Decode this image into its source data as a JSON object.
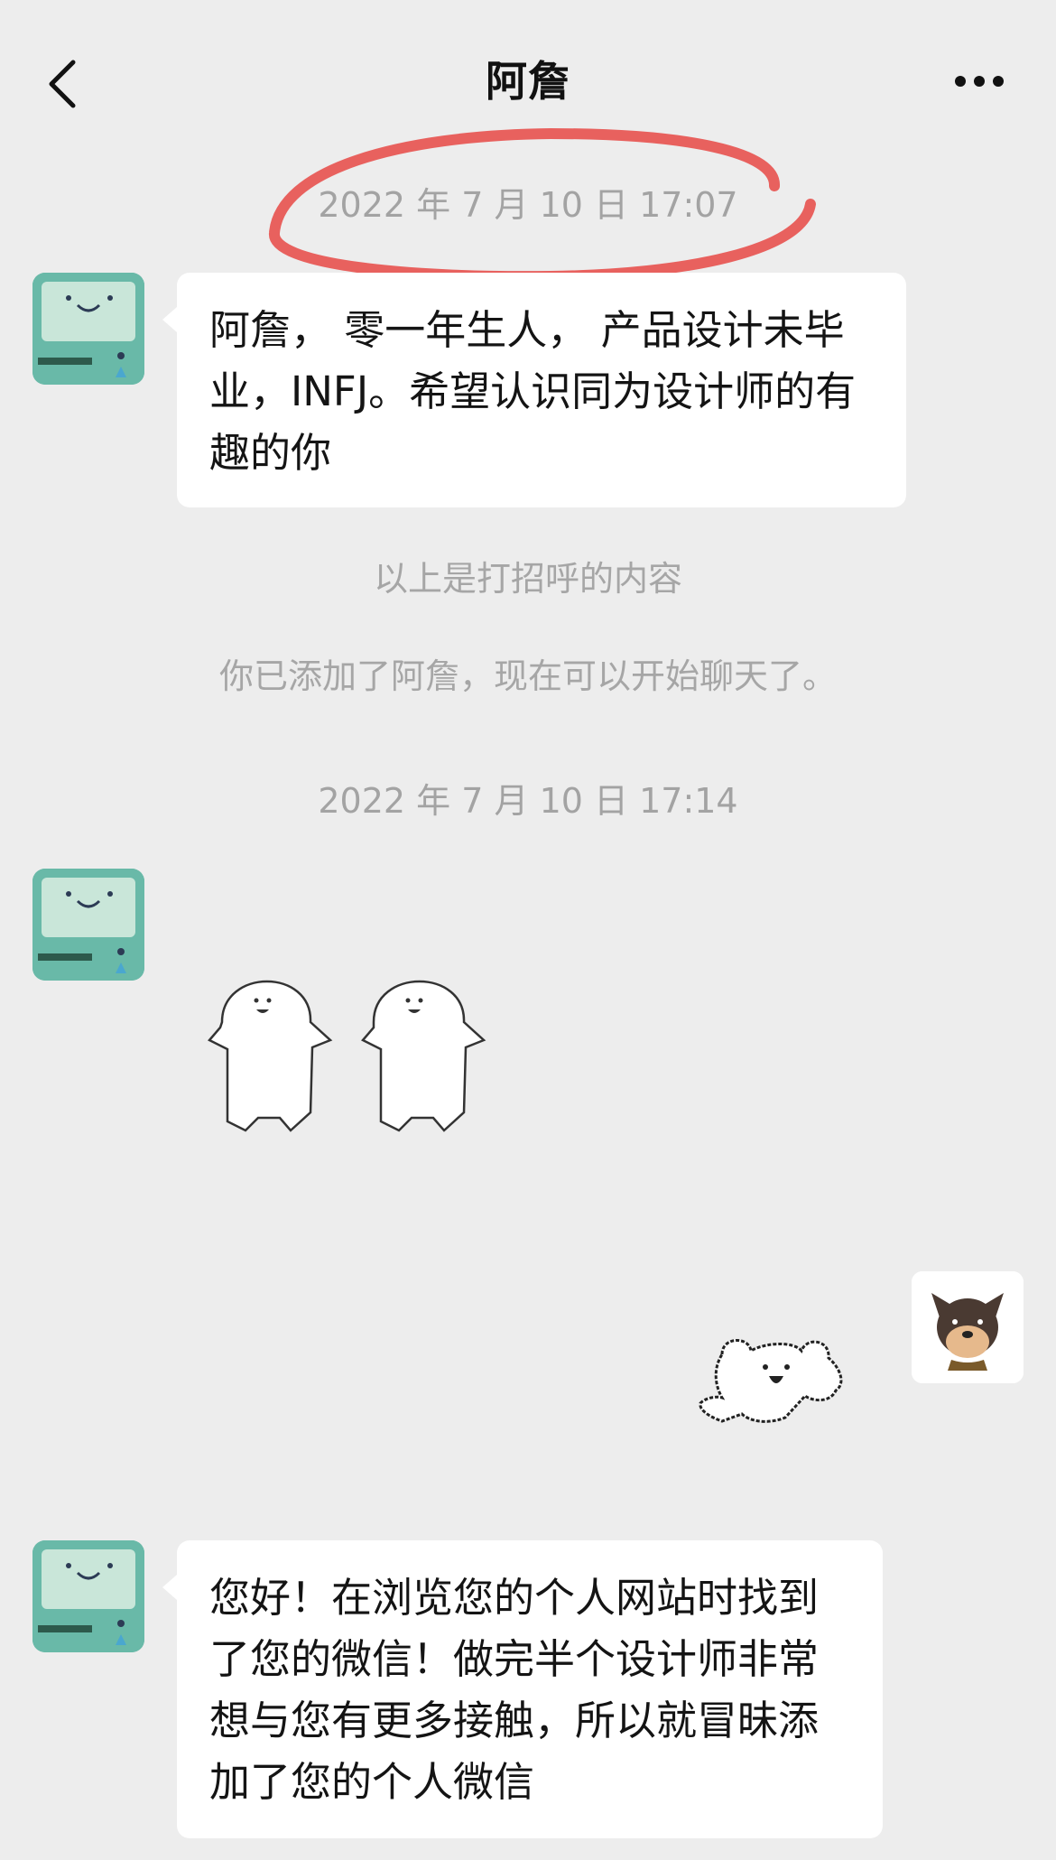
{
  "header": {
    "title": "阿詹",
    "back_icon": "chevron-left-icon",
    "more_icon": "more-dots-icon"
  },
  "messages": {
    "ts1": "2022 年 7 月 10 日 17:07",
    "greeting": "阿詹， 零一年生人， 产品设计未毕业，INFJ。希望认识同为设计师的有趣的你",
    "sys_greeting_end": "以上是打招呼的内容",
    "sys_added": "你已添加了阿詹，现在可以开始聊天了。",
    "ts2": "2022 年 7 月 10 日 17:14",
    "sticker1": "two-waving-blobs-sticker",
    "sticker2": "happy-puppy-sticker",
    "last": "您好！在浏览您的个人网站时找到了您的微信！做完半个设计师非常想与您有更多接触，所以就冒昧添加了您的个人微信"
  },
  "colors": {
    "background": "#ededed",
    "bubble": "#ffffff",
    "annotation_circle": "#e8615e",
    "avatar_teal": "#69b9a8"
  }
}
